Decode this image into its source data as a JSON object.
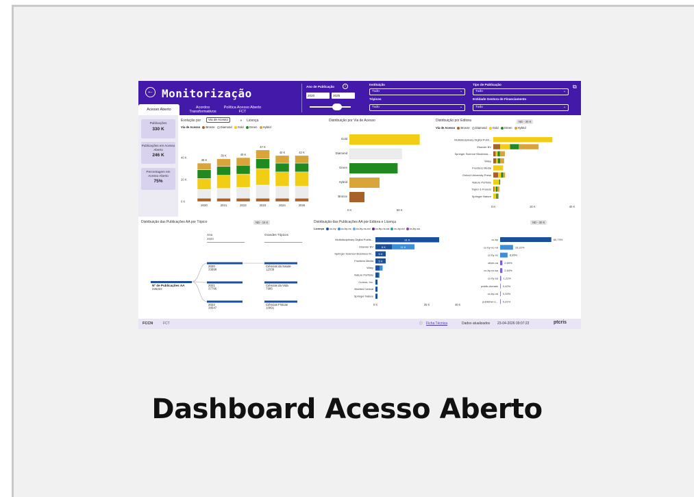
{
  "caption": "Dashboard Acesso Aberto",
  "header": {
    "title": "Monitorização",
    "tabs": [
      "Acesso Aberto",
      "Acordos Transformativos",
      "Política Acesso Aberto FCT"
    ]
  },
  "filters": {
    "year_label": "Ano de Publicação",
    "year_from": "2020",
    "year_to": "2025",
    "instituicao_label": "Instituição",
    "instituicao_value": "Tudo",
    "topicos_label": "Tópicos",
    "topicos_value": "Tudo",
    "tipo_label": "Tipo de Publicação",
    "tipo_value": "Tudo",
    "entidade_label": "Entidade Gestora de Financiamento",
    "entidade_value": "Tudo"
  },
  "kpis": [
    {
      "label": "Publicações",
      "value": "330 K"
    },
    {
      "label": "Publicações em Acesso Aberto",
      "value": "246 K"
    },
    {
      "label": "Percentagem em Acesso Aberto",
      "value": "75%"
    }
  ],
  "colors": {
    "Bronze": "#a7622b",
    "Diamond": "#ececec",
    "Gold": "#f2cd15",
    "Green": "#1f8a1f",
    "Hybrid": "#d9a43a",
    "header": "#4219a8",
    "license_primary": "#1b4f9c",
    "license_secondary": "#3a8fd8"
  },
  "evolution": {
    "title_prefix": "Evolução por",
    "toggle_a": "Via de Acesso",
    "toggle_b": "Licença",
    "legend_title": "Via de Acesso",
    "legend": [
      "Bronze",
      "Diamond",
      "Gold",
      "Green",
      "Hybrid"
    ]
  },
  "access_route": {
    "title": "Distribuição por Via de Acesso"
  },
  "publisher": {
    "title": "Distribuição por Editora",
    "pill": "ND - 30 K",
    "legend_title": "Via de Acesso",
    "legend": [
      "Bronze",
      "Diamond",
      "Gold",
      "Green",
      "Hybrid"
    ]
  },
  "topics": {
    "title": "Distribuição das Publicações AA por Tópico",
    "pill": "ND - 15 K",
    "col_headers": [
      "Ano",
      "Grandes Tópicos"
    ],
    "col_subs": [
      "2020",
      ""
    ],
    "root": {
      "label": "Nº de Publicações AA",
      "value": "226222"
    },
    "years": [
      {
        "label": "2020",
        "value": "33998"
      },
      {
        "label": "2021",
        "value": "37796"
      },
      {
        "label": "2022",
        "value": "38547"
      }
    ],
    "topics": [
      {
        "label": "Ciências da Saúde",
        "value": "12339"
      },
      {
        "label": "Ciências da Vida",
        "value": "7985"
      },
      {
        "label": "Ciências Físicas",
        "value": "10891"
      }
    ]
  },
  "pub_license": {
    "title": "Distribuição das Publicações AA por Editora e Licença",
    "pill": "ND - 30 K",
    "legend_title": "Licença",
    "legend": [
      "cc-by",
      "cc-by-nc",
      "cc-by-nc-nd",
      "cc-by-nc-sa",
      "cc-by-nd",
      "cc-by-sa"
    ],
    "legend_colors": [
      "#1b4f9c",
      "#3a8fd8",
      "#6aa9e6",
      "#5b2c91",
      "#2aa198",
      "#8e44ad"
    ]
  },
  "footer": {
    "logo_left": "FCCN",
    "logo_left2": "FCT",
    "link": "Ficha Técnica",
    "updated_label": "Dados atualizados",
    "updated_value": "23-04-2026 09:07:22",
    "logo_right": "ptcris"
  },
  "chart_data": [
    {
      "type": "bar",
      "stacked": true,
      "categories": [
        "2020",
        "2021",
        "2022",
        "2023",
        "2024",
        "2025"
      ],
      "totals_labels": [
        "35 K",
        "39 K",
        "40 K",
        "47 K",
        "42 K",
        "42 K"
      ],
      "yticks": [
        "0 K",
        "20 K",
        "40 K"
      ],
      "ylim": [
        0,
        50
      ],
      "series": [
        {
          "name": "Bronze",
          "values": [
            3,
            3,
            3,
            3,
            3,
            3
          ]
        },
        {
          "name": "Diamond",
          "values": [
            8,
            9,
            10,
            12,
            11,
            11
          ]
        },
        {
          "name": "Gold",
          "values": [
            10,
            12,
            12,
            15,
            13,
            13
          ]
        },
        {
          "name": "Green",
          "values": [
            8,
            8,
            8,
            9,
            8,
            8
          ]
        },
        {
          "name": "Hybrid",
          "values": [
            6,
            7,
            7,
            8,
            7,
            7
          ]
        }
      ]
    },
    {
      "type": "bar",
      "orientation": "horizontal",
      "categories": [
        "Gold",
        "Diamond",
        "Green",
        "Hybrid",
        "Bronze"
      ],
      "values": [
        70,
        52,
        48,
        30,
        15
      ],
      "xticks": [
        "0 K",
        "50 K"
      ],
      "xlim": [
        0,
        75
      ]
    },
    {
      "type": "bar",
      "orientation": "horizontal",
      "stacked": true,
      "categories": [
        "Multidisciplinary Digital Publi...",
        "Elsevier BV",
        "Springer Science+Business ...",
        "Wiley",
        "Frontiers Media",
        "Oxford University Press",
        "Nature Portfolio",
        "Taylor & Francis",
        "Springer Nature"
      ],
      "xticks": [
        "0 K",
        "20 K",
        "40 K"
      ],
      "xlim": [
        0,
        40
      ],
      "series": [
        {
          "name": "Bronze",
          "values": [
            0,
            3.5,
            1.2,
            1.5,
            0,
            2.5,
            0,
            0.6,
            0
          ]
        },
        {
          "name": "Diamond",
          "values": [
            0,
            0,
            0,
            0,
            0,
            0,
            0,
            0,
            0
          ]
        },
        {
          "name": "Gold",
          "values": [
            30,
            5,
            1,
            0.8,
            5,
            1.5,
            3,
            0.7,
            1.5
          ]
        },
        {
          "name": "Green",
          "values": [
            0,
            4.5,
            1.2,
            1.2,
            0,
            1,
            0.5,
            0.8,
            0.8
          ]
        },
        {
          "name": "Hybrid",
          "values": [
            0,
            10,
            2.5,
            2,
            0,
            1,
            0,
            1,
            0.5
          ]
        }
      ]
    },
    {
      "type": "bar",
      "orientation": "horizontal",
      "stacked": true,
      "categories": [
        "Multidisciplinary Digital Publis...",
        "Elsevier BV",
        "Springer Science+Business M...",
        "Frontiers Media",
        "Wiley",
        "Nature Portfolio",
        "Cureus, Inc.",
        "BioMed Central",
        "Springer Nature"
      ],
      "xticks": [
        "0 K",
        "25 K",
        "40 K"
      ],
      "xlim": [
        0,
        40
      ],
      "series": [
        {
          "name": "cc-by",
          "values": [
            31,
            8,
            5,
            5,
            2,
            1.5,
            1,
            1,
            1
          ],
          "labels": [
            "31 K",
            "8 K",
            "5 K",
            "5 K",
            "",
            "",
            "",
            "",
            ""
          ]
        },
        {
          "name": "cc-by-nc",
          "values": [
            0,
            11,
            0,
            0,
            1.5,
            0.5,
            0,
            0,
            0
          ],
          "labels": [
            "",
            "11 K",
            "",
            "",
            "",
            "",
            "",
            "",
            ""
          ]
        }
      ]
    },
    {
      "type": "bar",
      "orientation": "horizontal",
      "categories": [
        "cc-by",
        "cc-by-nc-nd",
        "cc-by-nc",
        "other-oa",
        "cc-by-nc-sa",
        "cc-by-sa",
        "public-domain",
        "cc-by-nd",
        "publisher-s..."
      ],
      "values": [
        60.73,
        15.32,
        8.85,
        2.69,
        2.64,
        1.21,
        0.42,
        0.33,
        0.31
      ],
      "labels": [
        "60,73%",
        "15,32%",
        "8,85%",
        "2,69%",
        "2,64%",
        "1,21%",
        "0,42%",
        "0,33%",
        "0,31%"
      ],
      "xlim": [
        0,
        65
      ]
    }
  ]
}
